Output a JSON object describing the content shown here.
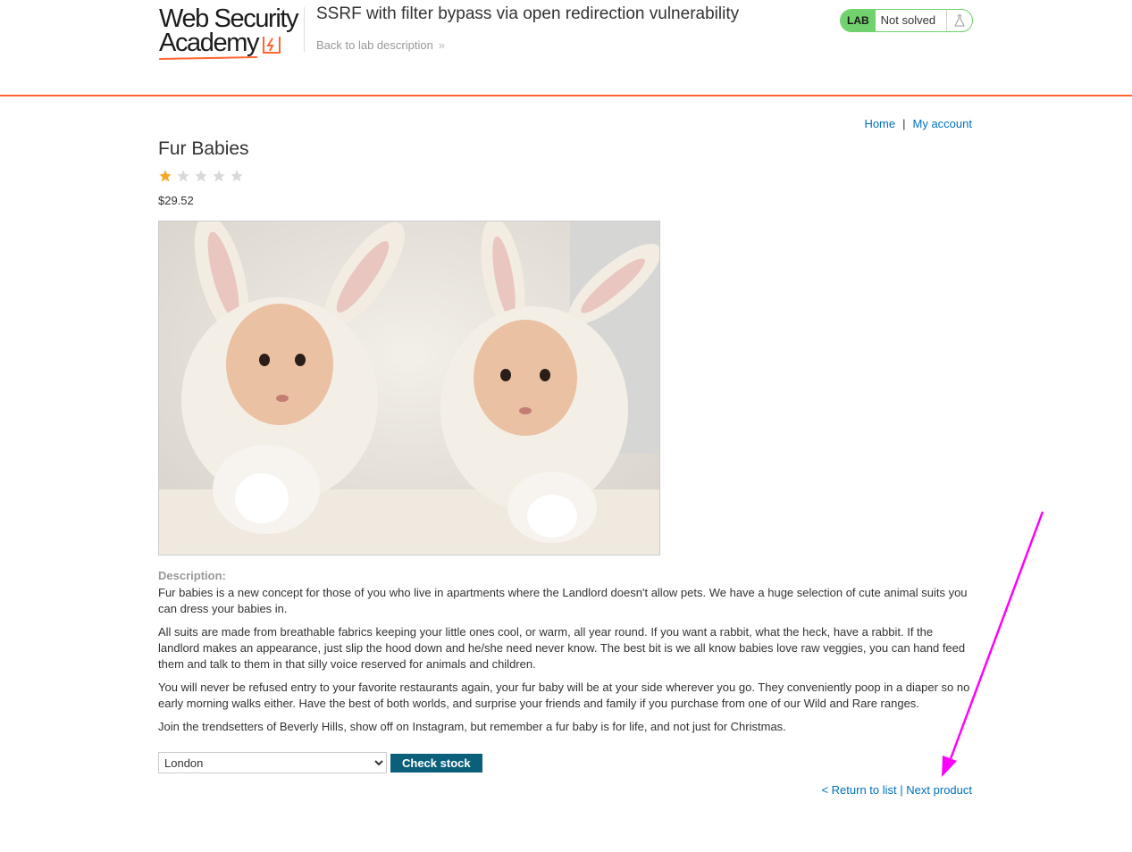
{
  "header": {
    "logo": {
      "line1": "Web Security",
      "line2": "Academy"
    },
    "lab_title": "SSRF with filter bypass via open redirection vulnerability",
    "back_link": "Back to lab description",
    "status": {
      "badge": "LAB",
      "text": "Not solved"
    }
  },
  "topnav": {
    "home": "Home",
    "separator": "|",
    "my_account": "My account"
  },
  "product": {
    "title": "Fur Babies",
    "rating": 1,
    "rating_max": 5,
    "price": "$29.52",
    "description_label": "Description:",
    "description": [
      "Fur babies is a new concept for those of you who live in apartments where the Landlord doesn't allow pets. We have a huge selection of cute animal suits you can dress your babies in.",
      "All suits are made from breathable fabrics keeping your little ones cool, or warm, all year round. If you want a rabbit, what the heck, have a rabbit. If the landlord makes an appearance, just slip the hood down and he/she need never know. The best bit is we all know babies love raw veggies, you can hand feed them and talk to them in that silly voice reserved for animals and children.",
      "You will never be refused entry to your favorite restaurants again, your fur baby will be at your side wherever you go. They conveniently poop in a diaper so no early morning walks either. Have the best of both worlds, and surprise your friends and family if you purchase from one of our Wild and Rare ranges.",
      "Join the trendsetters of Beverly Hills, show off on Instagram, but remember a fur baby is for life, and not just for Christmas."
    ]
  },
  "stock": {
    "selected_store": "London",
    "button": "Check stock"
  },
  "bottom": {
    "return": "< Return to list",
    "separator": "|",
    "next": "Next product"
  },
  "colors": {
    "accent": "#ff6633",
    "link": "#0071bc",
    "button": "#0c5f7a",
    "lab_green": "#70d16d",
    "star": "#f5a623",
    "annotation": "#ff00ff"
  },
  "icons": [
    "flask-icon",
    "chevron-right-icon",
    "star-icon",
    "arrow-annotation"
  ]
}
